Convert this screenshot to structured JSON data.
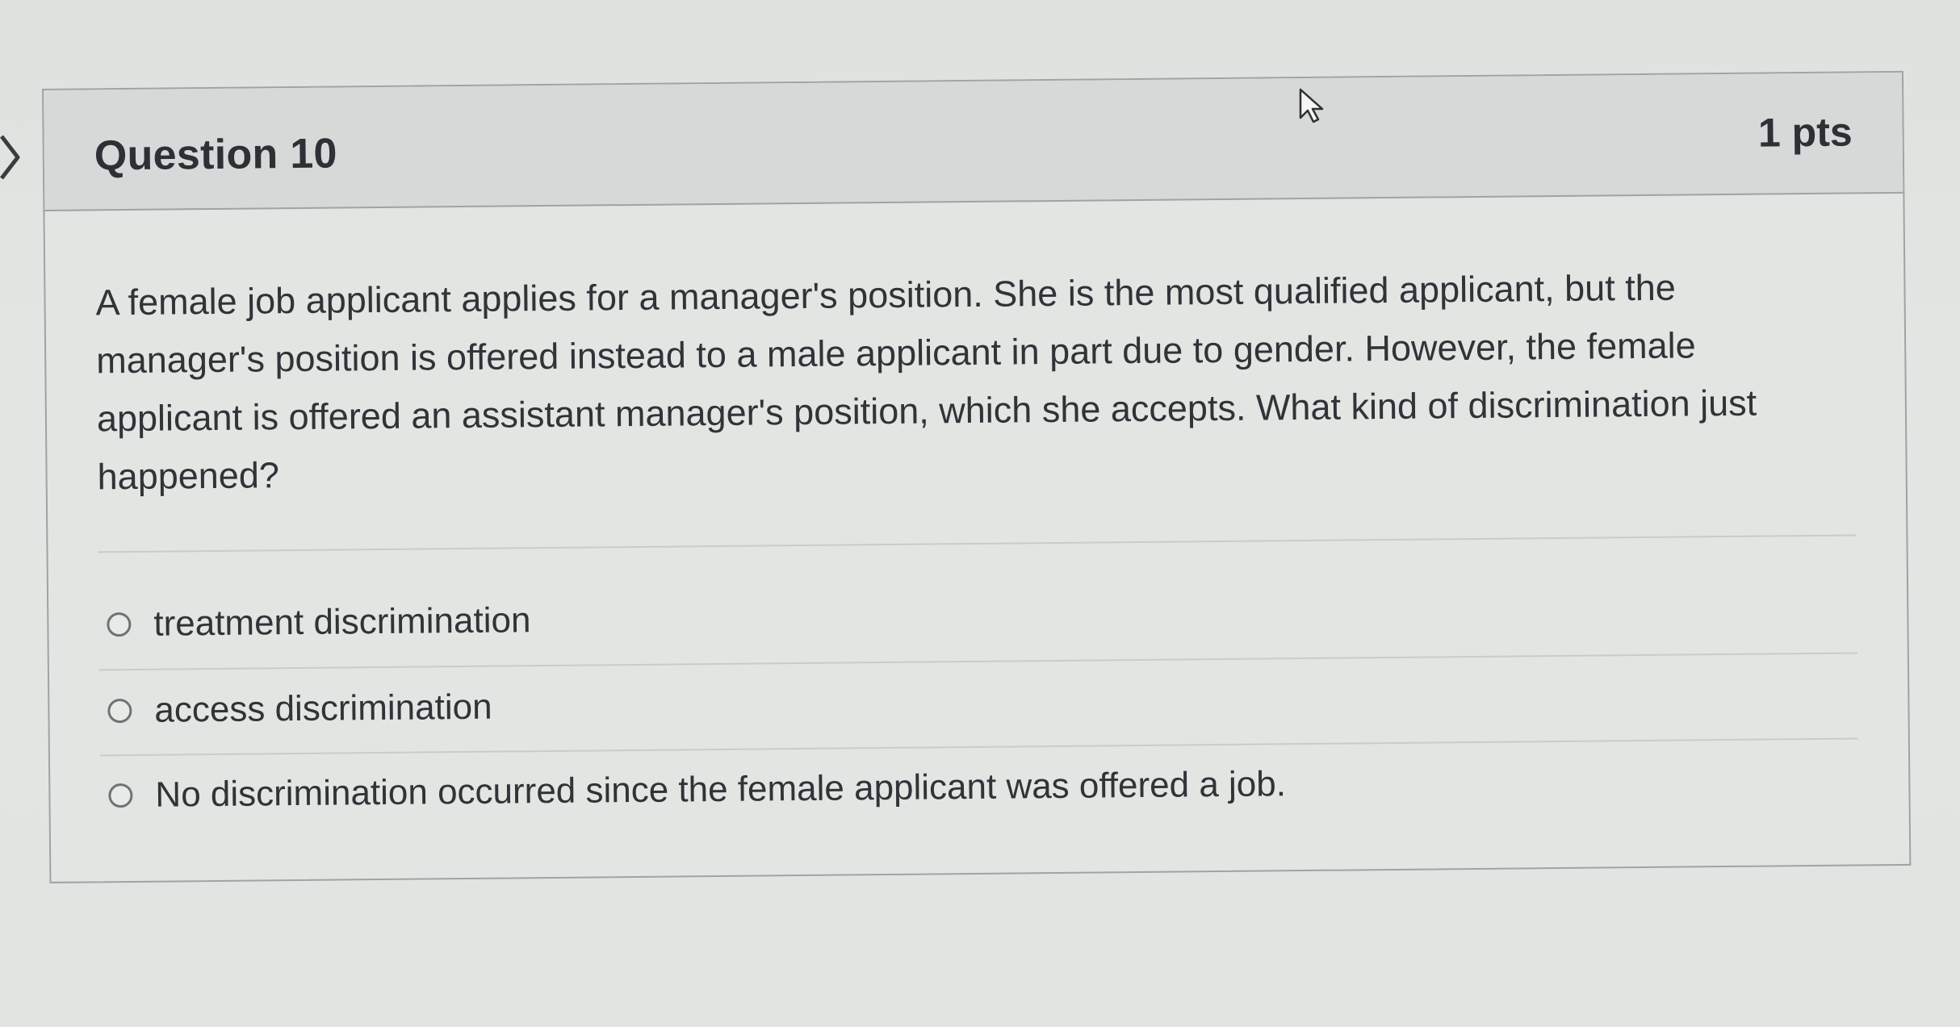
{
  "question": {
    "title": "Question 10",
    "points": "1 pts",
    "text": "A female job applicant applies for a manager's position. She is the most qualified applicant, but the manager's position is offered instead to a male applicant in part due to gender. However, the female applicant is offered an assistant manager's position, which she accepts. What kind of discrimination just happened?"
  },
  "answers": [
    {
      "label": "treatment discrimination",
      "selected": false
    },
    {
      "label": "access discrimination",
      "selected": false
    },
    {
      "label": "No discrimination occurred since the female applicant was offered a job.",
      "selected": false
    }
  ],
  "icons": {
    "edge": "chevron-right-icon",
    "cursor": "mouse-pointer-icon"
  },
  "colors": {
    "page_background": "#e2e4e2",
    "header_background": "#d7d9d8",
    "border": "#9fa3a5",
    "text": "#2f3236"
  }
}
